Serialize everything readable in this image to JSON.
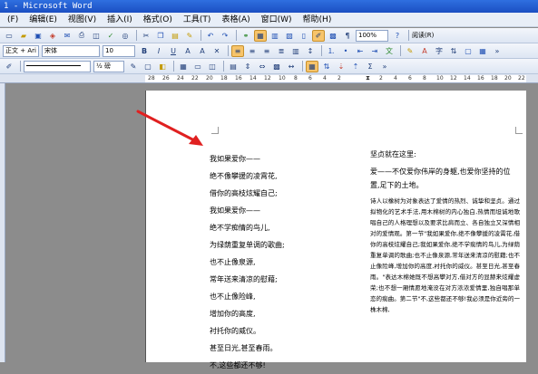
{
  "window": {
    "title": "1 - Microsoft Word"
  },
  "menu": [
    "编辑(E)",
    "视图(V)",
    "插入(I)",
    "格式(O)",
    "工具(T)",
    "表格(A)",
    "窗口(W)",
    "帮助(H)"
  ],
  "menu_first": "(F)",
  "toolbar1": {
    "zoom": "100%",
    "reading": "阅读(R)"
  },
  "toolbar2": {
    "style": "正文 + Ari",
    "font": "宋体",
    "size": "10",
    "bold": "B",
    "italic": "I",
    "underline": "U"
  },
  "toolbar3": {
    "line_style": "",
    "line_weight": "½ 磅"
  },
  "ruler": {
    "ticks": [
      "28",
      "26",
      "24",
      "22",
      "20",
      "18",
      "16",
      "14",
      "12",
      "10",
      "8",
      "6",
      "4",
      "2",
      "2",
      "4",
      "6",
      "8",
      "10",
      "12",
      "14",
      "16",
      "18",
      "20",
      "22"
    ]
  },
  "document": {
    "col1": [
      "我如果爱你——",
      "绝不像攀援的凌霄花,",
      "借你的高枝炫耀自己;",
      "我如果爱你——",
      "绝不学痴情的鸟儿,",
      "为绿荫重复单调的歌曲;",
      "也不止像泉源,",
      "常年送来清凉的慰藉;",
      "也不止像险峰,",
      "增加你的高度,",
      "衬托你的威仪。",
      "甚至日光,甚至春雨。",
      "不,这些都还不够!"
    ],
    "col2_heading1": "坚贞就在这里:",
    "col2_heading2": "爱——不仅爱你伟岸的身躯,也爱你坚持的位置,足下的土地。",
    "col2_body": "诗人以橡树为对象表达了爱情的热烈、诚挚和坚贞。通过拟物化的艺术手法,用木棉树的内心独白,热情而坦诚地歌唱自己的人格理想以及要求比肩而立、各自独立又深情相对的爱情观。第一节\"我如果爱你,绝不像攀援的凌霄花,借你的高枝炫耀自己;我如果爱你,绝不学痴情的鸟儿,为绿荫重复单调的歌曲;也不止像泉源,常年送来清凉的慰藉;也不止像险峰,增加你的高度,衬托你的威仪。甚至日光,甚至春雨。\"表达木棉她既不想高攀对方,借对方的显赫来炫耀虚荣;也不想一厢情愿地淹没在对方浓浓爱情里,独自唱那单恋的痴曲。第二节\"不,这些都还不够!我必须是你近旁的一株木棉,"
  }
}
